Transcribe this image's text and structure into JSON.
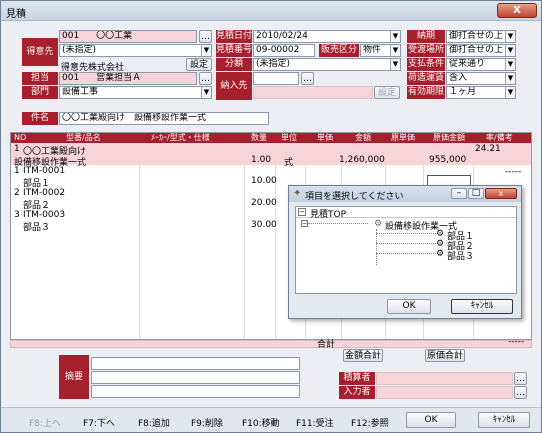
{
  "window": {
    "title": "見積",
    "close": "X"
  },
  "customer": {
    "label": "得意先",
    "code": "001",
    "name": "〇〇工業",
    "sub": "(未指定)",
    "company": "得意先株式会社",
    "settings_btn": "設定"
  },
  "staff": {
    "label": "担当",
    "code": "001",
    "name": "営業担当Ａ"
  },
  "dept": {
    "label": "部門",
    "value": "設備工事"
  },
  "estimate": {
    "date_label": "見積日付",
    "date": "2010/02/24",
    "no_label": "見積番号",
    "no": "09-00002",
    "type_label": "販売区分",
    "type": "物件",
    "class_label": "分類",
    "class": "(未指定)",
    "delivery_label": "納入先",
    "delivery_btn": "設定"
  },
  "terms": {
    "due_label": "納期",
    "due": "御打合せの上",
    "place_label": "受渡場所",
    "place": "御打合せの上",
    "pay_label": "支払条件",
    "pay": "従来通り",
    "ship_label": "荷造運賃",
    "ship": "含入",
    "valid_label": "有効期限",
    "valid": "１ヶ月"
  },
  "subject": {
    "label": "件名",
    "value": "〇〇工業殿向け　設備移設作業一式"
  },
  "grid": {
    "headers": [
      "NO",
      "型番/品名",
      "ﾒｰｶｰ/型式・仕様",
      "数量",
      "単位",
      "単価",
      "金額",
      "原単価",
      "原価金額",
      "率/備考"
    ],
    "rows": [
      {
        "no": "1",
        "code": "〇〇工業殿向け",
        "name": "設備移設作業一式",
        "qty": "1.00",
        "unit": "式",
        "price": "",
        "amount": "1,260,000",
        "cost": "955,000",
        "note": "24.21",
        "pink": true
      },
      {
        "no": "1",
        "code": "ITM-0001",
        "name": "部品１",
        "qty": "10.00",
        "note": "-----"
      },
      {
        "no": "2",
        "code": "ITM-0002",
        "name": "部品２",
        "qty": "20.00"
      },
      {
        "no": "3",
        "code": "ITM-0003",
        "name": "部品３",
        "qty": "30.00"
      }
    ],
    "total_label": "合計",
    "total_note": "-----"
  },
  "summary": {
    "amount_total_btn": "金額合計",
    "cost_total_btn": "原価合計"
  },
  "memo": {
    "label": "摘要"
  },
  "approval": {
    "label": "積算者",
    "entry_label": "入力者"
  },
  "dialog": {
    "title": "項目を選択してください",
    "root": "見積TOP",
    "parent": "設備移設作業一式",
    "children": [
      "部品１",
      "部品２",
      "部品３"
    ],
    "ok": "OK",
    "cancel": "ｷｬﾝｾﾙ"
  },
  "footer": {
    "f8up": "F8:上へ",
    "f7": "F7:下へ",
    "f8add": "F8:追加",
    "f9": "F9:削除",
    "f10": "F10:移動",
    "f11": "F11:受注",
    "f12": "F12:参照",
    "ok": "OK",
    "cancel": "ｷｬﾝｾﾙ"
  }
}
